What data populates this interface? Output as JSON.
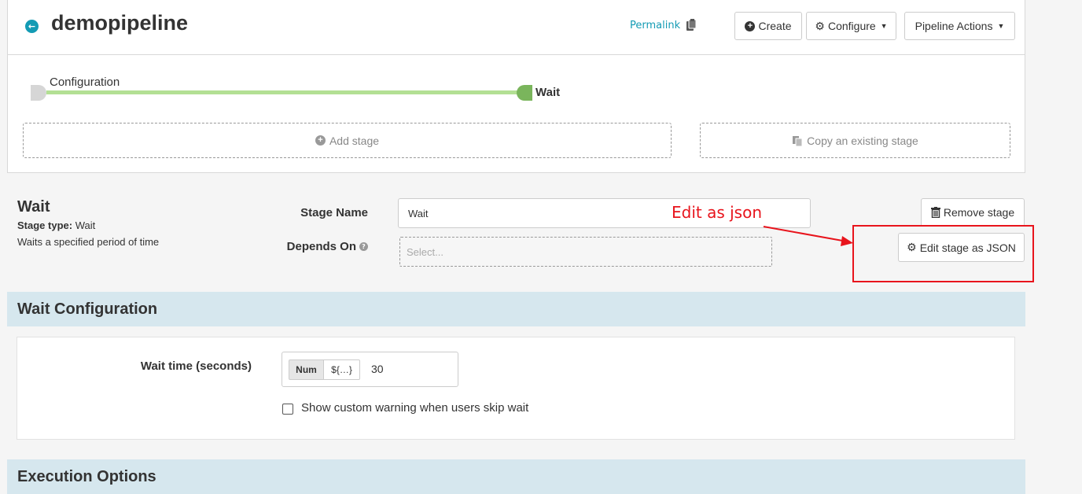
{
  "header": {
    "back_icon": "arrow-left-circle-icon",
    "pipeline_name": "demopipeline",
    "permalink_label": "Permalink",
    "clipboard_icon": "clipboard-icon",
    "create_label": "Create",
    "configure_label": "Configure",
    "actions_label": "Pipeline Actions"
  },
  "graph": {
    "nodes": [
      {
        "label": "Configuration",
        "color": "#d6d6d6"
      },
      {
        "label": "Wait",
        "color": "#7ab55c"
      }
    ],
    "edge_color": "#b3e094",
    "add_stage_label": "Add stage",
    "copy_stage_label": "Copy an existing stage"
  },
  "stage": {
    "title": "Wait",
    "type_label": "Stage type:",
    "type_value": "Wait",
    "description": "Waits a specified period of time",
    "name_label": "Stage Name",
    "name_value": "Wait",
    "depends_label": "Depends On",
    "depends_placeholder": "Select...",
    "remove_label": "Remove stage",
    "edit_json_label": "Edit stage as JSON"
  },
  "annotation": {
    "text": "Edit as json",
    "color": "#e8141c"
  },
  "wait_config": {
    "section_title": "Wait Configuration",
    "wait_time_label": "Wait time (seconds)",
    "mode_num": "Num",
    "mode_expr": "${…}",
    "wait_time_value": "30",
    "skip_warning_label": "Show custom warning when users skip wait",
    "skip_warning_checked": false
  },
  "execution_options": {
    "section_title": "Execution Options"
  },
  "colors": {
    "accent": "#139bb4",
    "section_bg": "#d6e7ee"
  }
}
